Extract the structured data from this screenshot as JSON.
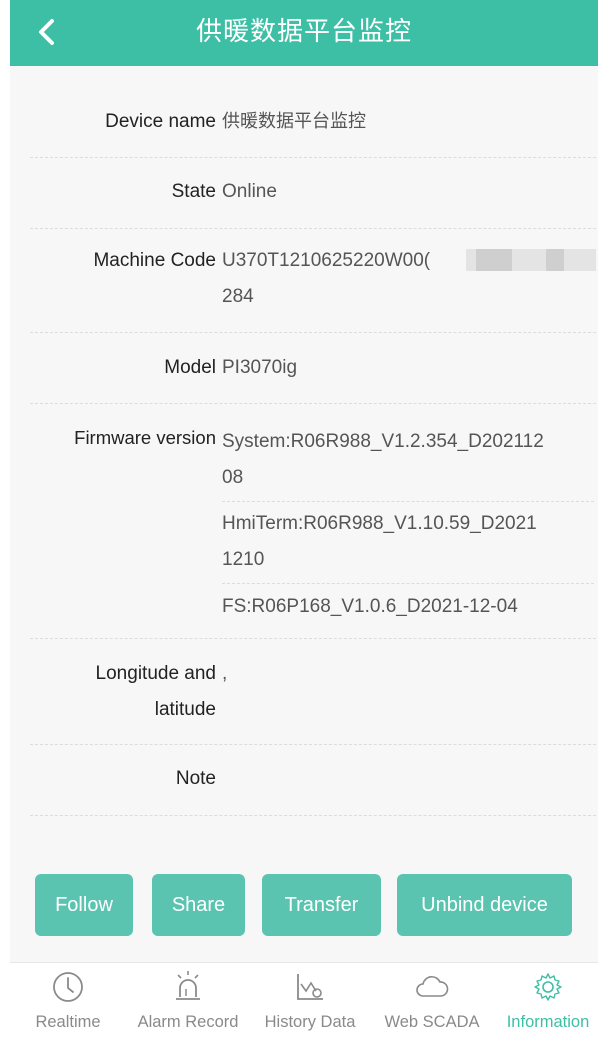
{
  "header": {
    "title": "供暖数据平台监控"
  },
  "info": {
    "device_name": {
      "label": "Device name",
      "value": "供暖数据平台监控"
    },
    "state": {
      "label": "State",
      "value": "Online"
    },
    "machine_code": {
      "label": "Machine Code",
      "value_line1": "U370T1210625220W00(",
      "value_line2": "284"
    },
    "model": {
      "label": "Model",
      "value": "PI3070ig"
    },
    "firmware": {
      "label": "Firmware version",
      "items": [
        {
          "line1": "System:R06R988_V1.2.354_D202112",
          "line2": "08"
        },
        {
          "line1": "HmiTerm:R06R988_V1.10.59_D2021",
          "line2": "1210"
        },
        {
          "line1": "FS:R06P168_V1.0.6_D2021-12-04",
          "line2": ""
        }
      ]
    },
    "location": {
      "label_line1": "Longitude and",
      "label_line2": "latitude",
      "value": ","
    },
    "note": {
      "label": "Note",
      "value": ""
    }
  },
  "actions": {
    "follow": "Follow",
    "share": "Share",
    "transfer": "Transfer",
    "unbind": "Unbind device"
  },
  "tabs": [
    {
      "label": "Realtime",
      "icon": "clock-icon",
      "active": false
    },
    {
      "label": "Alarm Record",
      "icon": "alarm-siren-icon",
      "active": false
    },
    {
      "label": "History Data",
      "icon": "history-chart-icon",
      "active": false
    },
    {
      "label": "Web SCADA",
      "icon": "cloud-icon",
      "active": false
    },
    {
      "label": "Information",
      "icon": "gear-icon",
      "active": true
    }
  ],
  "colors": {
    "accent": "#3dbfa6",
    "button": "#5bc4b0",
    "tab_inactive": "#8a8a8a"
  }
}
